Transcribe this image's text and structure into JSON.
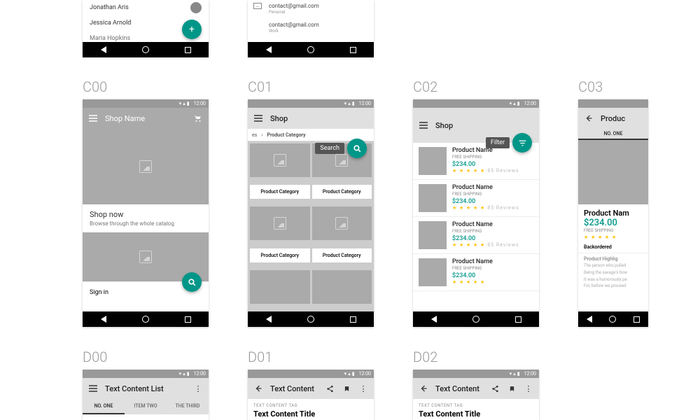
{
  "status_time": "12:00",
  "labels": {
    "c00": "C00",
    "c01": "C01",
    "c02": "C02",
    "c03": "C03",
    "d00": "D00",
    "d01": "D01",
    "d02": "D02"
  },
  "top_left": {
    "contacts": [
      "Jonathan Aris",
      "Jessica Arnold",
      "Maria Hopkins"
    ]
  },
  "top_right": {
    "emails": [
      {
        "addr": "contact@gmail.com",
        "type": "Personal"
      },
      {
        "addr": "contact@gmail.com",
        "type": "Work"
      }
    ]
  },
  "c00": {
    "title": "Shop Name",
    "card_h": "Shop now",
    "card_s": "Browse through the whole catalog",
    "signin": "Sign in"
  },
  "c01": {
    "title": "Shop",
    "crumb_a": "es",
    "crumb_sep": "›",
    "crumb_b": "Product Category",
    "search_pill": "Search",
    "cat_label": "Product Category"
  },
  "c02": {
    "title": "Shop",
    "filter_pill": "Filter",
    "product": {
      "name": "Product Name",
      "ship": "FREE SHIPPING",
      "price": "$234.00",
      "reviews": "85 Reviews"
    }
  },
  "c03": {
    "title": "Produc",
    "tab": "NO. ONE",
    "name": "Product Nam",
    "price": "$234.00",
    "ship": "FREE SHIPPING",
    "back": "Backordered",
    "high_t": "Product Highlig",
    "high_p1": "The person who pulled",
    "high_p2": "Being the savage's bow",
    "high_p3": "It was a humorously pe",
    "high_p4": "For, before we proceed"
  },
  "d00": {
    "title": "Text Content List",
    "tabs": [
      "NO. ONE",
      "ITEM TWO",
      "THE THIRD"
    ]
  },
  "d01": {
    "title": "Text Content",
    "tag": "TEXT CONTENT TAG",
    "heading": "Text Content Title"
  },
  "d02": {
    "title": "Text Content",
    "tag": "TEXT CONTENT TAG",
    "heading": "Text Content Title"
  }
}
